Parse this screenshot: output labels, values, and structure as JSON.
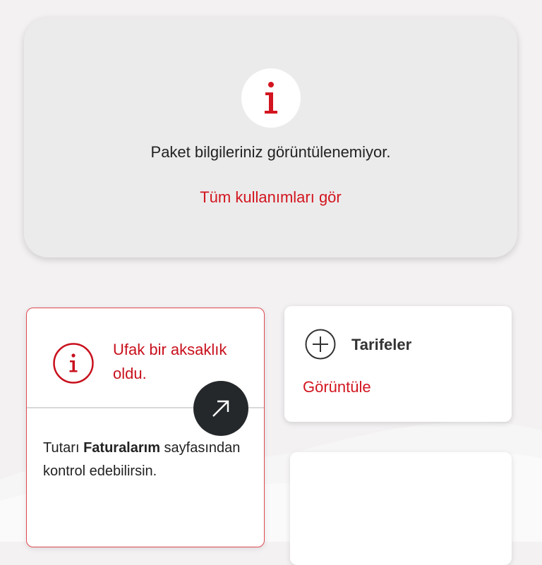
{
  "info_card": {
    "icon": "info-icon",
    "message": "Paket bilgileriniz görüntülenemiyor.",
    "link_label": "Tüm kullanımları gör"
  },
  "error_card": {
    "icon": "info-circle-icon",
    "title": "Ufak bir aksaklık oldu.",
    "body_prefix": "Tutarı ",
    "body_bold": "Faturalarım",
    "body_suffix": " sayfasından kontrol edebilirsin.",
    "arrow_icon": "arrow-up-right-icon"
  },
  "tariff_card": {
    "icon": "plus-circle-icon",
    "title": "Tarifeler",
    "link_label": "Görüntüle"
  },
  "colors": {
    "brand_red": "#d2151f",
    "background": "#f3f1f2",
    "card_grey": "#ecebeb",
    "dark_button": "#25282b"
  }
}
